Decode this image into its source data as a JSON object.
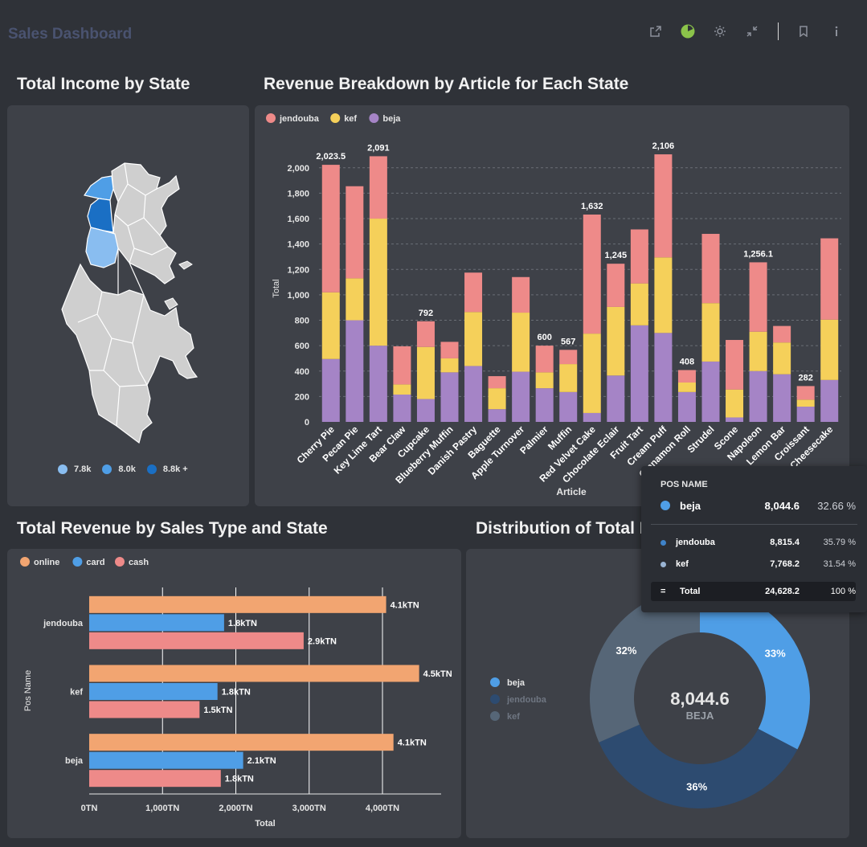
{
  "header": {
    "title": "Sales Dashboard"
  },
  "toolbar": {
    "icons": [
      "share-icon",
      "pie-status-icon",
      "settings-icon",
      "collapse-icon",
      "bookmark-icon",
      "info-icon"
    ]
  },
  "sections": {
    "map_title": "Total Income by State",
    "bar_title": "Revenue Breakdown by Article for Each State",
    "hbar_title": "Total Revenue by Sales Type and State",
    "donut_title": "Distribution of Total I"
  },
  "map_legend": [
    {
      "label": "7.8k",
      "color": "#89bdf0"
    },
    {
      "label": "8.0k",
      "color": "#4f9ee6"
    },
    {
      "label": "8.8k +",
      "color": "#1a6fc4"
    }
  ],
  "chart_data": [
    {
      "type": "bar",
      "stacked": true,
      "title": "Revenue Breakdown by Article for Each State",
      "xlabel": "Article",
      "ylabel": "Total",
      "ylim": [
        0,
        2100
      ],
      "yticks": [
        0,
        200,
        400,
        600,
        800,
        1000,
        1200,
        1400,
        1600,
        1800,
        2000
      ],
      "ytick_labels": [
        "0",
        "200",
        "400",
        "600",
        "800",
        "1,000",
        "1,200",
        "1,400",
        "1,600",
        "1,800",
        "2,000"
      ],
      "legend_position": "top-left",
      "categories": [
        "Cherry Pie",
        "Pecan Pie",
        "Key Lime Tart",
        "Bear Claw",
        "Cupcake",
        "Blueberry Muffin",
        "Danish Pastry",
        "Baguette",
        "Apple Turnover",
        "Palmier",
        "Muffin",
        "Red Velvet Cake",
        "Chocolate Eclair",
        "Fruit Tart",
        "Cream Puff",
        "Cinnamon Roll",
        "Strudel",
        "Scone",
        "Napoleon",
        "Lemon Bar",
        "Croissant",
        "Cheesecake"
      ],
      "series": [
        {
          "name": "beja",
          "color": "#a584c6",
          "values": [
            495,
            800,
            600,
            215,
            180,
            390,
            440,
            100,
            395,
            265,
            235,
            70,
            365,
            760,
            700,
            235,
            475,
            35,
            400,
            375,
            120,
            330
          ]
        },
        {
          "name": "kef",
          "color": "#f5d05a",
          "values": [
            525,
            330,
            1000,
            80,
            410,
            110,
            425,
            165,
            465,
            125,
            220,
            625,
            540,
            330,
            595,
            75,
            460,
            220,
            310,
            250,
            55,
            475
          ]
        },
        {
          "name": "jendouba",
          "color": "#ee8a89",
          "values": [
            1003.5,
            725,
            491,
            300,
            202,
            130,
            310,
            95,
            280,
            210,
            112,
            937,
            340,
            425,
            811,
            98,
            545,
            390,
            546.1,
            130,
            107,
            640
          ]
        }
      ],
      "total_labels": [
        {
          "category": "Cherry Pie",
          "label": "2,023.5"
        },
        {
          "category": "Key Lime Tart",
          "label": "2,091"
        },
        {
          "category": "Cupcake",
          "label": "792"
        },
        {
          "category": "Palmier",
          "label": "600"
        },
        {
          "category": "Muffin",
          "label": "567"
        },
        {
          "category": "Red Velvet Cake",
          "label": "1,632"
        },
        {
          "category": "Chocolate Eclair",
          "label": "1,245"
        },
        {
          "category": "Cream Puff",
          "label": "2,106"
        },
        {
          "category": "Cinnamon Roll",
          "label": "408"
        },
        {
          "category": "Napoleon",
          "label": "1,256.1"
        },
        {
          "category": "Croissant",
          "label": "282"
        }
      ]
    },
    {
      "type": "bar",
      "orientation": "horizontal",
      "title": "Total Revenue by Sales Type and State",
      "xlabel": "Total",
      "ylabel": "Pos Name",
      "xlim": [
        0,
        4800
      ],
      "xticks": [
        0,
        1000,
        2000,
        3000,
        4000
      ],
      "xtick_labels": [
        "0TN",
        "1,000TN",
        "2,000TN",
        "3,000TN",
        "4,000TN"
      ],
      "legend_position": "top-left",
      "categories": [
        "jendouba",
        "kef",
        "beja"
      ],
      "series": [
        {
          "name": "online",
          "color": "#f2a571",
          "values": [
            4050,
            4500,
            4150
          ],
          "labels": [
            "4.1kTN",
            "4.5kTN",
            "4.1kTN"
          ]
        },
        {
          "name": "card",
          "color": "#4f9ee6",
          "values": [
            1840,
            1750,
            2100
          ],
          "labels": [
            "1.8kTN",
            "1.8kTN",
            "2.1kTN"
          ]
        },
        {
          "name": "cash",
          "color": "#ee8a89",
          "values": [
            2925,
            1505,
            1795
          ],
          "labels": [
            "2.9kTN",
            "1.5kTN",
            "1.8kTN"
          ]
        }
      ]
    },
    {
      "type": "pie",
      "donut": true,
      "title": "Distribution of Total I",
      "legend_position": "left",
      "center_value": "8,044.6",
      "center_label": "BEJA",
      "slices": [
        {
          "name": "beja",
          "value": 8044.6,
          "percent_label": "33%",
          "color": "#4f9ee6"
        },
        {
          "name": "jendouba",
          "value": 8815.4,
          "percent_label": "36%",
          "color": "#2d4b70"
        },
        {
          "name": "kef",
          "value": 7768.2,
          "percent_label": "32%",
          "color": "#566677"
        }
      ]
    }
  ],
  "tooltip": {
    "header": "POS NAME",
    "highlight": {
      "name": "beja",
      "value": "8,044.6",
      "percent": "32.66 %"
    },
    "rows": [
      {
        "name": "jendouba",
        "value": "8,815.4",
        "percent": "35.79 %"
      },
      {
        "name": "kef",
        "value": "7,768.2",
        "percent": "31.54 %"
      }
    ],
    "total": {
      "symbol": "=",
      "name": "Total",
      "value": "24,628.2",
      "percent": "100 %"
    }
  }
}
